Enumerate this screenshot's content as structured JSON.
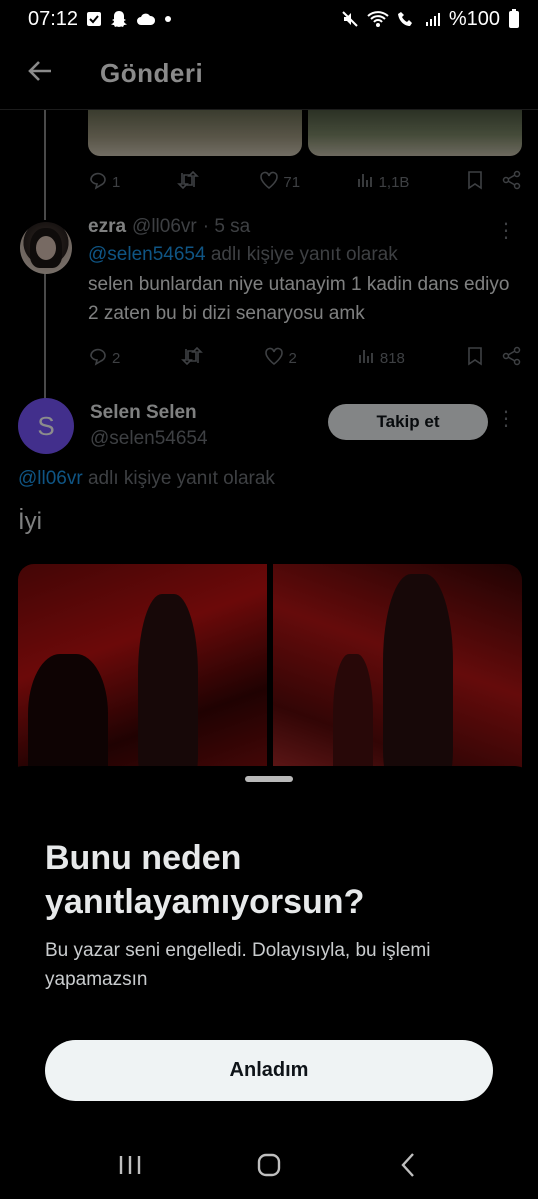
{
  "status_bar": {
    "time": "07:12",
    "battery": "%100",
    "icons_left": [
      "checkbox-icon",
      "snapchat-icon",
      "cloud-icon",
      "dot-icon"
    ],
    "icons_right": [
      "mute-icon",
      "wifi-icon",
      "wifi-call-icon",
      "signal-icon",
      "battery-icon"
    ]
  },
  "header": {
    "title": "Gönderi",
    "back_icon": "arrow-left-icon"
  },
  "first_tweet_actions": {
    "replies": "1",
    "retweets": "",
    "likes": "71",
    "views": "1,1B"
  },
  "reply_tweet": {
    "name": "ezra",
    "handle": "@ll06vr",
    "time": "· 5 sa",
    "reply_mention": "@selen54654",
    "reply_suffix": "adlı kişiye yanıt olarak",
    "text": "selen bunlardan niye utanayim 1 kadin dans ediyo 2 zaten bu bi dizi senaryosu amk",
    "replies": "2",
    "likes": "2",
    "views": "818"
  },
  "main_post": {
    "avatar_letter": "S",
    "name": "Selen Selen",
    "handle": "@selen54654",
    "follow_label": "Takip et",
    "reply_mention": "@ll06vr",
    "reply_suffix": "adlı kişiye yanıt olarak",
    "text": "İyi"
  },
  "sheet": {
    "title": "Bunu neden yanıtlayamıyorsun?",
    "description": "Bu yazar seni engelledi. Dolayısıyla, bu işlemi yapamazsın",
    "button_label": "Anladım"
  },
  "colors": {
    "accent": "#1d9bf0",
    "avatar_bg": "#7856ff",
    "background": "#000000",
    "button_bg": "#eff3f4"
  }
}
